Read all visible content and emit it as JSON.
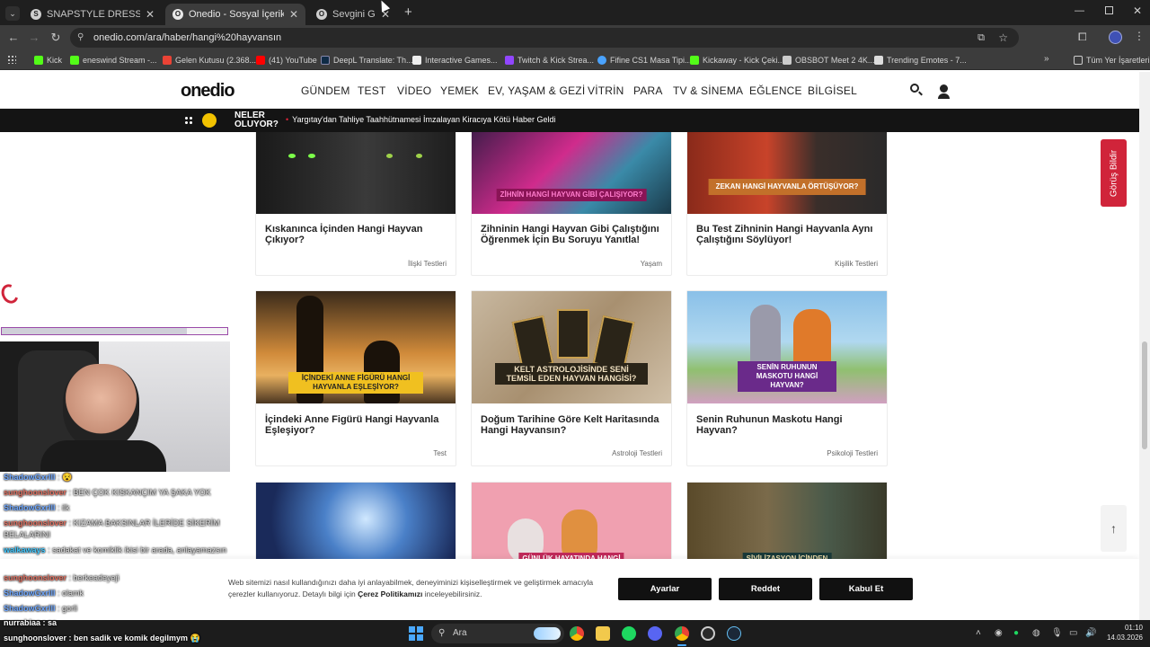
{
  "browser": {
    "tabs": [
      {
        "title": "SNAPSTYLE DRESS UP - Ücretsiz",
        "fav": "S"
      },
      {
        "title": "Onedio - Sosyal İçerik Platformu",
        "fav": "O"
      },
      {
        "title": "Sevgini Göster",
        "fav": "O"
      }
    ],
    "url": "onedio.com/ara/haber/hangi%20hayvansın",
    "bookmarks": [
      {
        "label": "Kick",
        "color": "#53fc18"
      },
      {
        "label": "eneswind Stream -...",
        "color": "#53fc18"
      },
      {
        "label": "Gelen Kutusu (2.368...",
        "color": "#ea4335"
      },
      {
        "label": "(41) YouTube",
        "color": "#ff0000"
      },
      {
        "label": "DeepL Translate: Th...",
        "color": "#0f2b46"
      },
      {
        "label": "Interactive Games...",
        "color": "#ffffff"
      },
      {
        "label": "Twitch & Kick Strea...",
        "color": "#9146ff"
      },
      {
        "label": "Fifine CS1 Masa Tipi...",
        "color": "#4aa3ff"
      },
      {
        "label": "Kickaway - Kick Çeki...",
        "color": "#53fc18"
      },
      {
        "label": "OBSBOT Meet 2 4K...",
        "color": "#cccccc"
      },
      {
        "label": "Trending Emotes - 7...",
        "color": "#ffffff"
      }
    ],
    "all_bookmarks": "Tüm Yer İşaretleri"
  },
  "site": {
    "logo": "onedio",
    "nav": [
      "GÜNDEM",
      "TEST",
      "VİDEO",
      "YEMEK",
      "EV, YAŞAM & GEZİ",
      "VİTRİN",
      "PARA",
      "TV & SİNEMA",
      "EĞLENCE",
      "BİLGİSEL"
    ],
    "ticker_label_1": "NELER",
    "ticker_label_2": "OLUYOR?",
    "ticker_news": "Yargıtay'dan Tahliye Taahhütnamesi İmzalayan Kiracıya Kötü Haber Geldi",
    "feedback": "Görüş Bildir",
    "cards": [
      {
        "title": "Kıskanınca İçinden Hangi Hayvan Çıkıyor?",
        "category": "İlişki Testleri",
        "overlay": ""
      },
      {
        "title": "Zihninin Hangi Hayvan Gibi Çalıştığını Öğrenmek İçin Bu Soruyu Yanıtla!",
        "category": "Yaşam",
        "overlay": "ZİHNİN HANGİ HAYVAN GİBİ ÇALIŞIYOR?"
      },
      {
        "title": "Bu Test Zihninin Hangi Hayvanla Aynı Çalıştığını Söylüyor!",
        "category": "Kişilik Testleri",
        "overlay": "ZEKAN HANGİ HAYVANLA ÖRTÜŞÜYOR?"
      },
      {
        "title": "İçindeki Anne Figürü Hangi Hayvanla Eşleşiyor?",
        "category": "Test",
        "overlay": "İÇİNDEKİ ANNE FİGÜRÜ HANGİ HAYVANLA EŞLEŞİYOR?"
      },
      {
        "title": "Doğum Tarihine Göre Kelt Haritasında Hangi Hayvansın?",
        "category": "Astroloji Testleri",
        "overlay": "KELT ASTROLOJİSİNDE SENİ TEMSİL EDEN HAYVAN HANGİSİ?"
      },
      {
        "title": "Senin Ruhunun Maskotu Hangi Hayvan?",
        "category": "Psikoloji Testleri",
        "overlay": "SENİN RUHUNUN MASKOTU HANGİ HAYVAN?"
      },
      {
        "title": "",
        "category": "",
        "overlay": ""
      },
      {
        "title": "",
        "category": "",
        "overlay": "GÜNLÜK HAYATINDA HANGİ"
      },
      {
        "title": "",
        "category": "",
        "overlay": "SİVİLİZASYON İÇİNDEN"
      }
    ],
    "cookie_text_1": "Web sitemizi nasıl kullandığınızı daha iyi anlayabilmek, deneyiminizi kişiselleştirmek ve geliştirmek amacıyla",
    "cookie_text_2": "çerezler kullanıyoruz. Detaylı bilgi için ",
    "cookie_link": "Çerez Politikamızı",
    "cookie_text_3": " inceleyebilirsiniz.",
    "cookie_buttons": [
      "Ayarlar",
      "Reddet",
      "Kabul Et"
    ]
  },
  "stream": {
    "chat": [
      {
        "user": "ShadowGxrlll",
        "msg": ": 😵",
        "cls": "u1"
      },
      {
        "user": "sunghoonslover",
        "msg": ": BEN ÇOK KISKANÇIM YA ŞAKA YOK",
        "cls": "u2"
      },
      {
        "user": "ShadowGxrlll",
        "msg": ": ilk",
        "cls": "u1"
      },
      {
        "user": "sunghoonslover",
        "msg": ": KIZAMA BAKSINLAR İLERİDE SİKERİM BELALARINI",
        "cls": "u2"
      },
      {
        "user": "walkaways",
        "msg": ": sadakat ve komiklik ikisi bir arada, anlayamazsın",
        "cls": "u3"
      },
      {
        "user": "sunghoonslover",
        "msg": ": berkeadeyeji",
        "cls": "u2"
      },
      {
        "user": "ShadowGxrlll",
        "msg": ": olamk",
        "cls": "u1"
      },
      {
        "user": "ShadowGxrlll",
        "msg": ": gorli",
        "cls": "u1"
      }
    ],
    "bottom_chat_1": "nurrabiaa : sa",
    "bottom_chat_2": "sunghoonslover : ben sadik ve komik degilmym 😭"
  },
  "taskbar": {
    "search": "Ara",
    "time": "01:10",
    "date": "14.03.2026"
  }
}
